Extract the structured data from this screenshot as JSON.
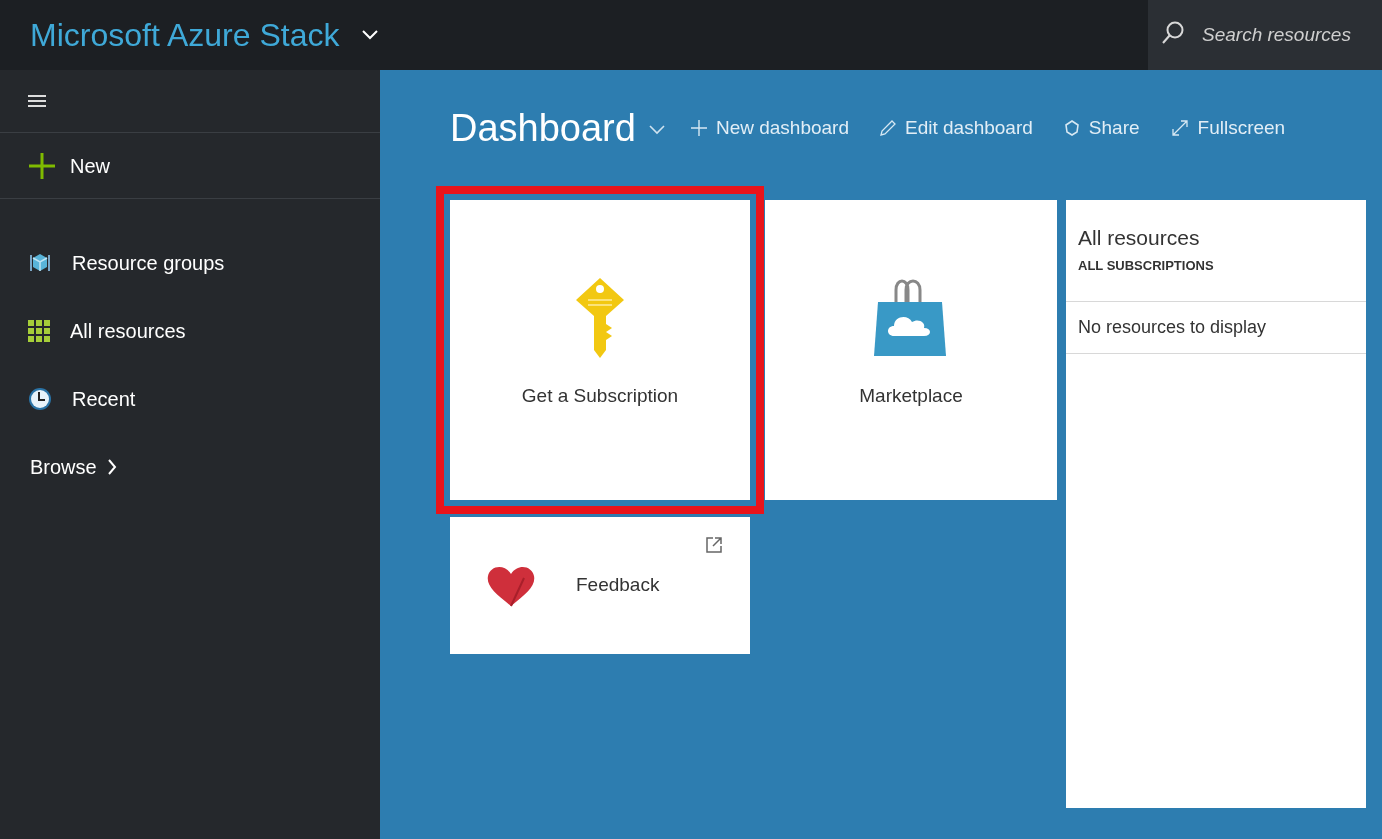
{
  "topbar": {
    "title": "Microsoft Azure Stack",
    "search": {
      "placeholder": "Search resources"
    }
  },
  "sidebar": {
    "new_label": "New",
    "items": [
      {
        "kind": "cube",
        "label": "Resource groups"
      },
      {
        "kind": "grid",
        "label": "All resources"
      },
      {
        "kind": "clock",
        "label": "Recent"
      }
    ],
    "browse": "Browse"
  },
  "dashboard": {
    "title": "Dashboard",
    "actions": [
      {
        "kind": "plus",
        "label": "New dashboard"
      },
      {
        "kind": "pencil",
        "label": "Edit dashboard"
      },
      {
        "kind": "share",
        "label": "Share"
      },
      {
        "kind": "expand",
        "label": "Fullscreen"
      }
    ],
    "tiles": [
      {
        "kind": "key",
        "label": "Get a Subscription",
        "highlighted": true
      },
      {
        "kind": "bag",
        "label": "Marketplace",
        "highlighted": false
      },
      {
        "kind": "heart",
        "label": "Feedback",
        "highlighted": false
      }
    ],
    "resources_tile": {
      "title": "All resources",
      "subtitle": "ALL SUBSCRIPTIONS",
      "empty_text": "No resources to display"
    }
  }
}
